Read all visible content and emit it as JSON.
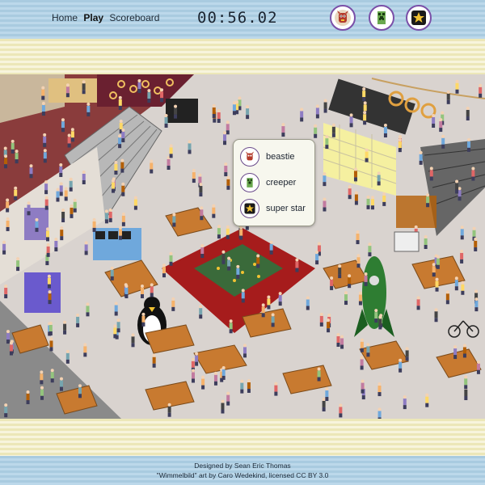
{
  "nav": {
    "home": "Home",
    "play": "Play",
    "scoreboard": "Scoreboard"
  },
  "timer": "00:56.02",
  "targets": [
    {
      "name": "beastie",
      "icon": "beastie-icon",
      "color": "#b33a2a"
    },
    {
      "name": "creeper",
      "icon": "creeper-icon",
      "color": "#6aa84f"
    },
    {
      "name": "super star",
      "icon": "super-star-icon",
      "color": "#f1c232"
    }
  ],
  "footer": {
    "line1": "Designed by Sean Eric Thomas",
    "line2": "\"Wimmelbild\" art by Caro Wedekind, licensed CC BY 3.0"
  },
  "colors": {
    "accent": "#7a4fa8",
    "band_blue": "#a9cbe0",
    "band_cream": "#ece7b8"
  }
}
